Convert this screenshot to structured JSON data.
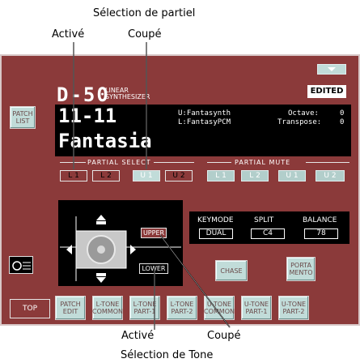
{
  "annotations": {
    "top_title": "Sélection de partiel",
    "top_left": "Activé",
    "top_right": "Coupé",
    "bottom_left": "Activé",
    "bottom_right": "Coupé",
    "bottom_title": "Sélection de Tone"
  },
  "header": {
    "logo": "D-50",
    "logo_sub1": "LINEAR",
    "logo_sub2": "SYNTHESIZER",
    "edited_badge": "EDITED"
  },
  "patch_list_button": "PATCH LIST",
  "display": {
    "patch_number": "11-11",
    "patch_name": "Fantasia",
    "upper_tone": "U:Fantasynth",
    "lower_tone": "L:FantasyPCM",
    "octave_label": "Octave:",
    "octave_value": "0",
    "transpose_label": "Transpose:",
    "transpose_value": "0"
  },
  "partial_select": {
    "title": "PARTIAL SELECT",
    "buttons": [
      "L 1",
      "L 2",
      "U 1",
      "U 2"
    ]
  },
  "partial_mute": {
    "title": "PARTIAL MUTE",
    "buttons": [
      "L 1",
      "L 2",
      "U 1",
      "U 2"
    ]
  },
  "tone_select": {
    "upper": "UPPER",
    "lower": "LOWER"
  },
  "keymode": {
    "headers": [
      "KEYMODE",
      "SPLIT",
      "BALANCE"
    ],
    "values": [
      "DUAL",
      "C4",
      "78"
    ]
  },
  "chase_button": "CHASE",
  "portamento_button": "PORTA MENTO",
  "bottom_tabs": [
    "TOP",
    "PATCH EDIT",
    "L-TONE COMMON",
    "L-TONE PART-1",
    "L-TONE PART-2",
    "U-TONE COMMON",
    "U-TONE PART-1",
    "U-TONE PART-2"
  ]
}
